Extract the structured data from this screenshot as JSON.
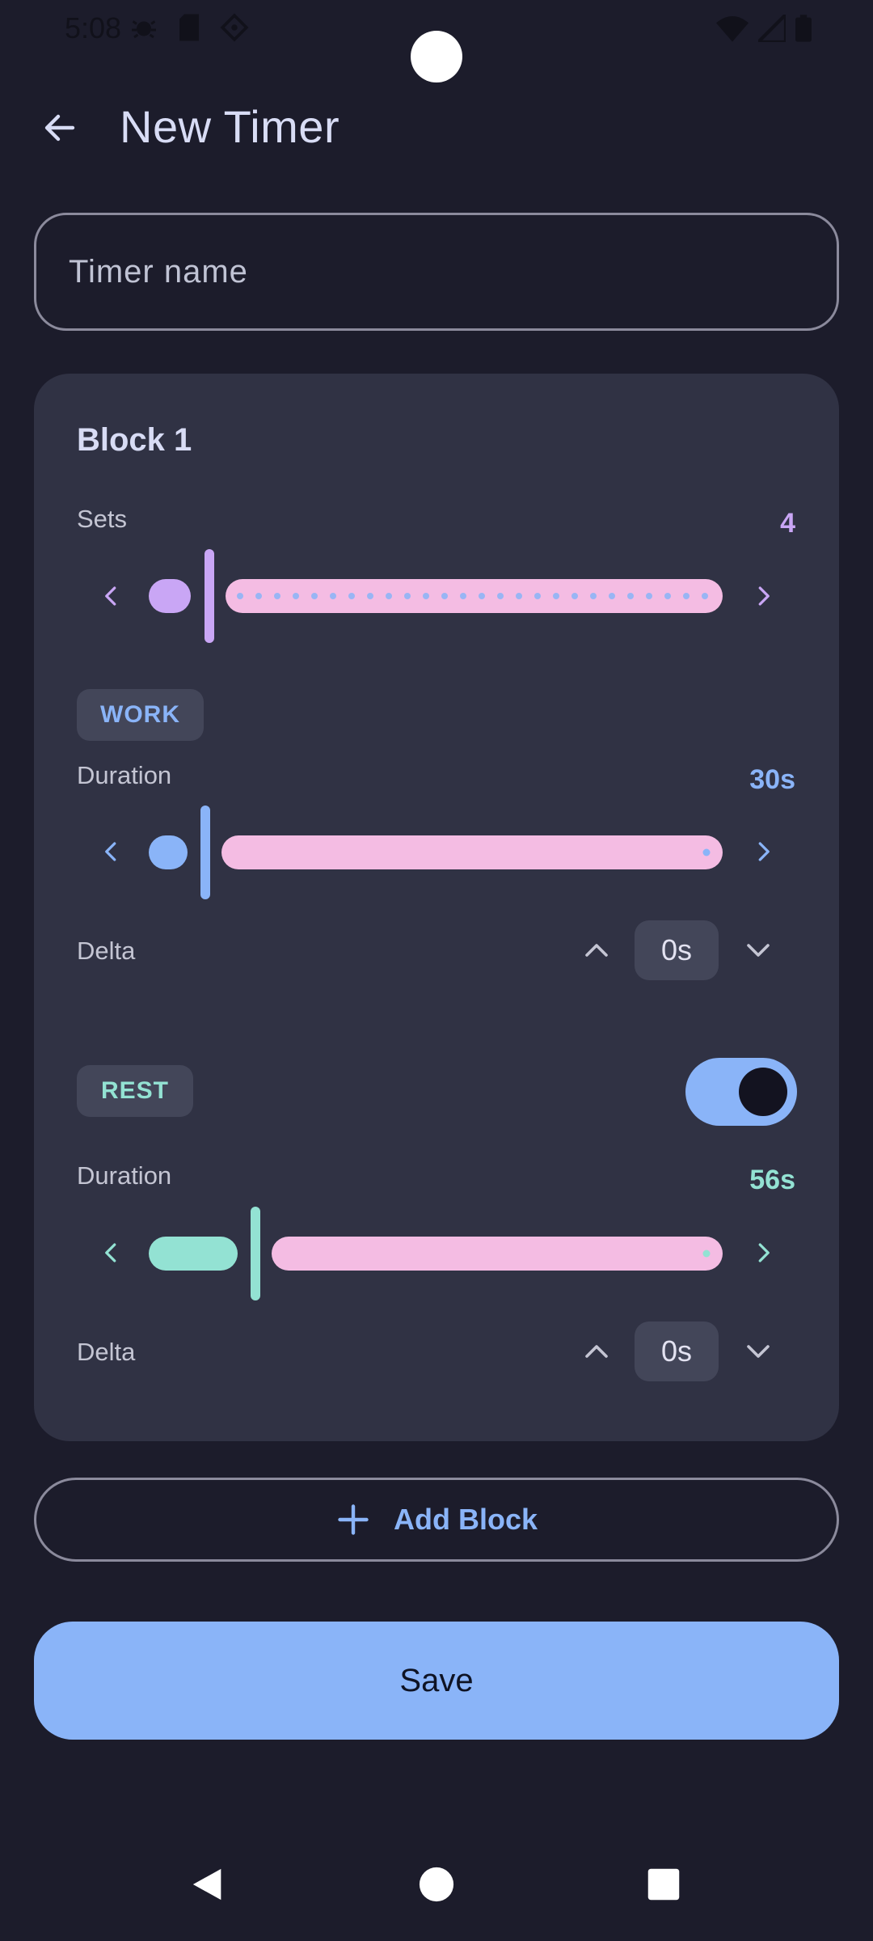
{
  "status_bar": {
    "time": "5:08"
  },
  "header": {
    "title": "New Timer"
  },
  "form": {
    "name_placeholder": "Timer name",
    "name_value": ""
  },
  "block": {
    "title": "Block 1",
    "sets": {
      "label": "Sets",
      "value": "4",
      "fill_fraction": 0.07,
      "color": "#c9a6f5"
    },
    "work": {
      "chip": "WORK",
      "duration": {
        "label": "Duration",
        "value": "30s",
        "fill_fraction": 0.06,
        "color": "#8ab4f8"
      },
      "delta": {
        "label": "Delta",
        "value": "0s"
      }
    },
    "rest": {
      "chip": "REST",
      "enabled": true,
      "duration": {
        "label": "Duration",
        "value": "56s",
        "fill_fraction": 0.15,
        "color": "#93e2d3"
      },
      "delta": {
        "label": "Delta",
        "value": "0s"
      }
    }
  },
  "actions": {
    "add_block_label": "Add Block",
    "save_label": "Save"
  },
  "colors": {
    "track": "#f4bce3",
    "accent": "#8ab4f8",
    "background": "#1c1c2b",
    "card": "#303244"
  }
}
